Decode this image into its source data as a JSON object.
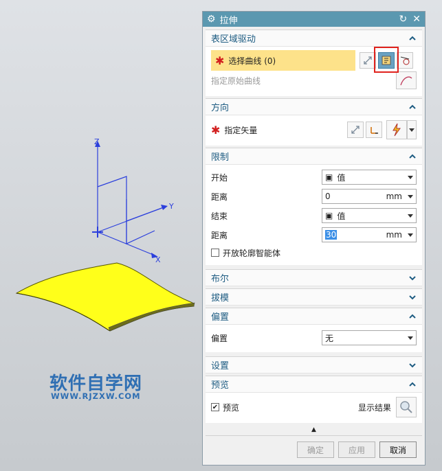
{
  "dialog": {
    "title": "拉伸",
    "icons": {
      "settings": "gear-icon",
      "reset": "reset-icon",
      "close": "close-icon"
    }
  },
  "sections": {
    "surface": {
      "title": "表区域驱动",
      "select_curve": "选择曲线 (0)",
      "specify_original": "指定原始曲线"
    },
    "direction": {
      "title": "方向",
      "specify_vector": "指定矢量"
    },
    "limits": {
      "title": "限制",
      "start_label": "开始",
      "start_value": "值",
      "dist1_label": "距离",
      "dist1_value": "0",
      "dist1_unit": "mm",
      "end_label": "结束",
      "end_value": "值",
      "dist2_label": "距离",
      "dist2_value": "30",
      "dist2_unit": "mm",
      "open_profile": "开放轮廓智能体"
    },
    "boolean": {
      "title": "布尔"
    },
    "draft": {
      "title": "拔模"
    },
    "offset": {
      "title": "偏置",
      "label": "偏置",
      "value": "无"
    },
    "settings": {
      "title": "设置"
    },
    "preview": {
      "title": "预览",
      "preview_label": "预览",
      "show_result": "显示结果"
    }
  },
  "footer": {
    "ok": "确定",
    "apply": "应用",
    "cancel": "取消"
  },
  "viewport": {
    "axis_z": "Z",
    "axis_y": "Y",
    "axis_x": "X",
    "watermark_cn": "软件自学网",
    "watermark_url": "WWW.RJZXW.COM"
  },
  "colors": {
    "title_bar": "#5b98b0",
    "section_title": "#1e5c82",
    "highlight": "#fde28a",
    "surface": "#ffff1a",
    "axis": "#2b3fdc"
  }
}
